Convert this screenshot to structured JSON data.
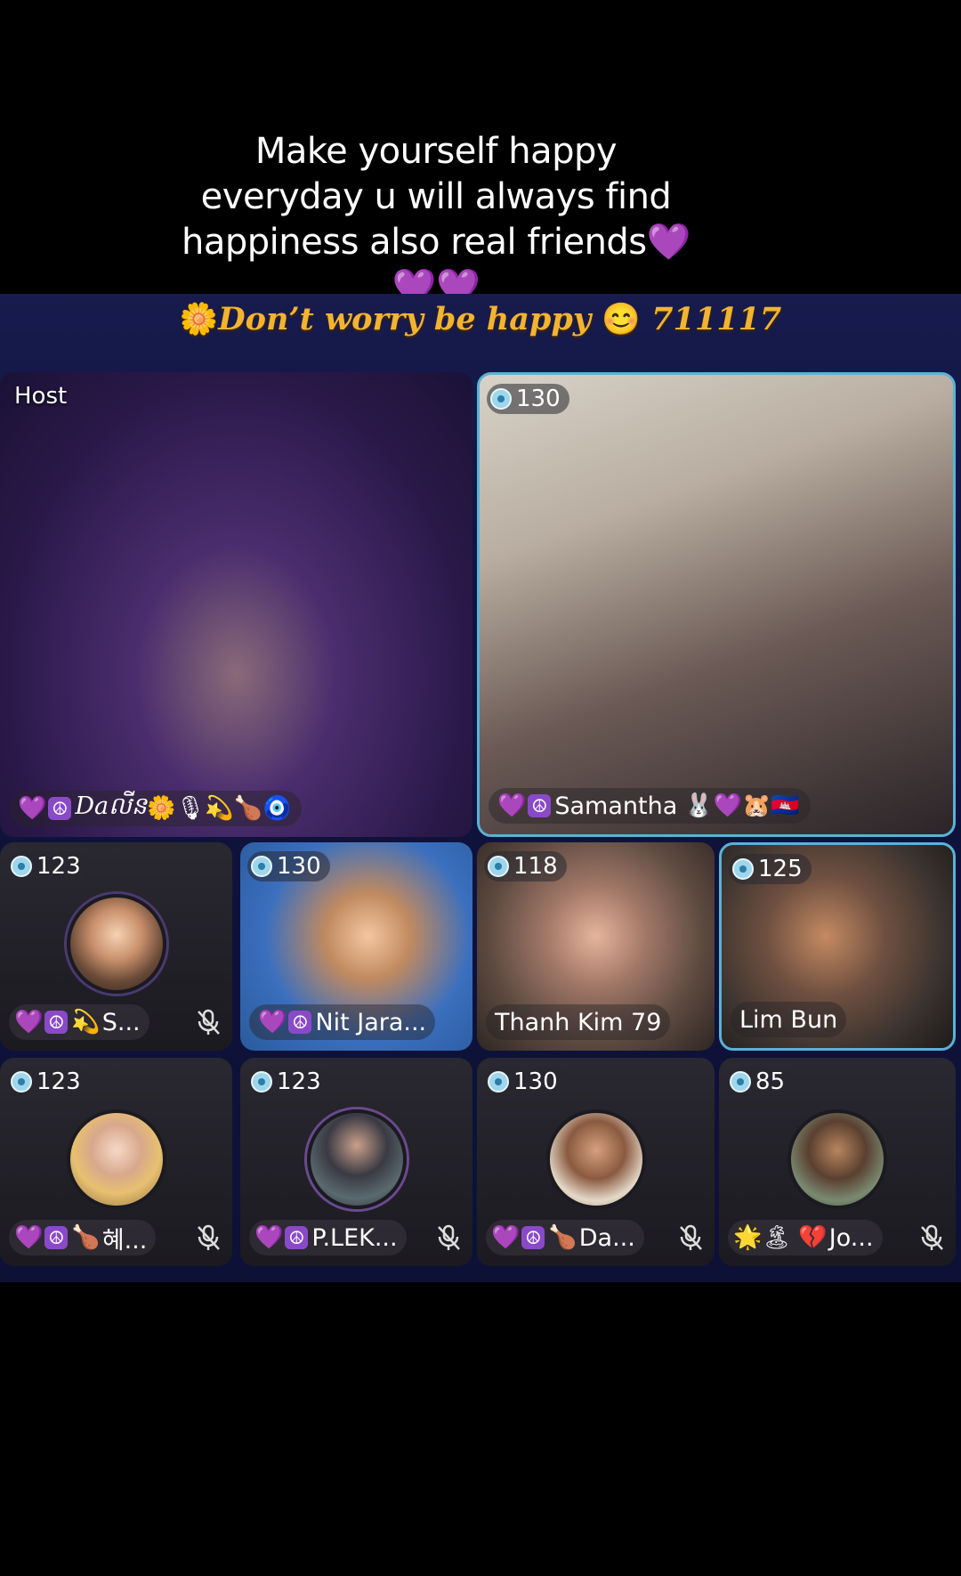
{
  "caption": {
    "line1": "Make yourself happy",
    "line2": "everyday u will always find",
    "line3": "happiness also real friends💜",
    "line4": "💜💜"
  },
  "room": {
    "title_icon": "🌼",
    "title": "Don’t worry be happy",
    "title_emoji": "😊",
    "room_id": "711117"
  },
  "host_tile": {
    "label": "Host",
    "name": "Daលីន",
    "emojis_before": "💜",
    "emojis_after": "🌼🎙💫🍗🧿"
  },
  "guest_main": {
    "level": "130",
    "name": "Samantha",
    "emojis_before": "💜",
    "emojis_after": "🐰💜🐹🇰🇭"
  },
  "row1": [
    {
      "level": "123",
      "name": "S...",
      "emojis_before": "💜",
      "emojis_after": "💫",
      "muted": true
    },
    {
      "level": "130",
      "name": "Nit Jara...",
      "emojis_before": "💜",
      "emojis_after": "",
      "muted": false
    },
    {
      "level": "118",
      "name": "Thanh Kim 79",
      "muted": false
    },
    {
      "level": "125",
      "name": "Lim Bun",
      "muted": false
    }
  ],
  "row2": [
    {
      "level": "123",
      "name": "혜...",
      "emojis_before": "💜",
      "emojis_after": "🍗",
      "muted": true
    },
    {
      "level": "123",
      "name": "P.LEK...",
      "emojis_before": "💜",
      "emojis_after": "",
      "muted": true
    },
    {
      "level": "130",
      "name": "Da...",
      "emojis_before": "💜",
      "emojis_after": "🍗",
      "muted": true
    },
    {
      "level": "85",
      "name": "Jo...",
      "emojis_before": "🌟🏝",
      "emojis_after": "💔",
      "muted": true
    }
  ],
  "colors": {
    "accent_border": "#5ab2d6",
    "title_gold": "#f2b430",
    "stage_bg": "#101440"
  },
  "icons": {
    "level": "level-badge-icon",
    "mute": "mic-muted-icon",
    "peace": "peace-symbol-icon"
  }
}
